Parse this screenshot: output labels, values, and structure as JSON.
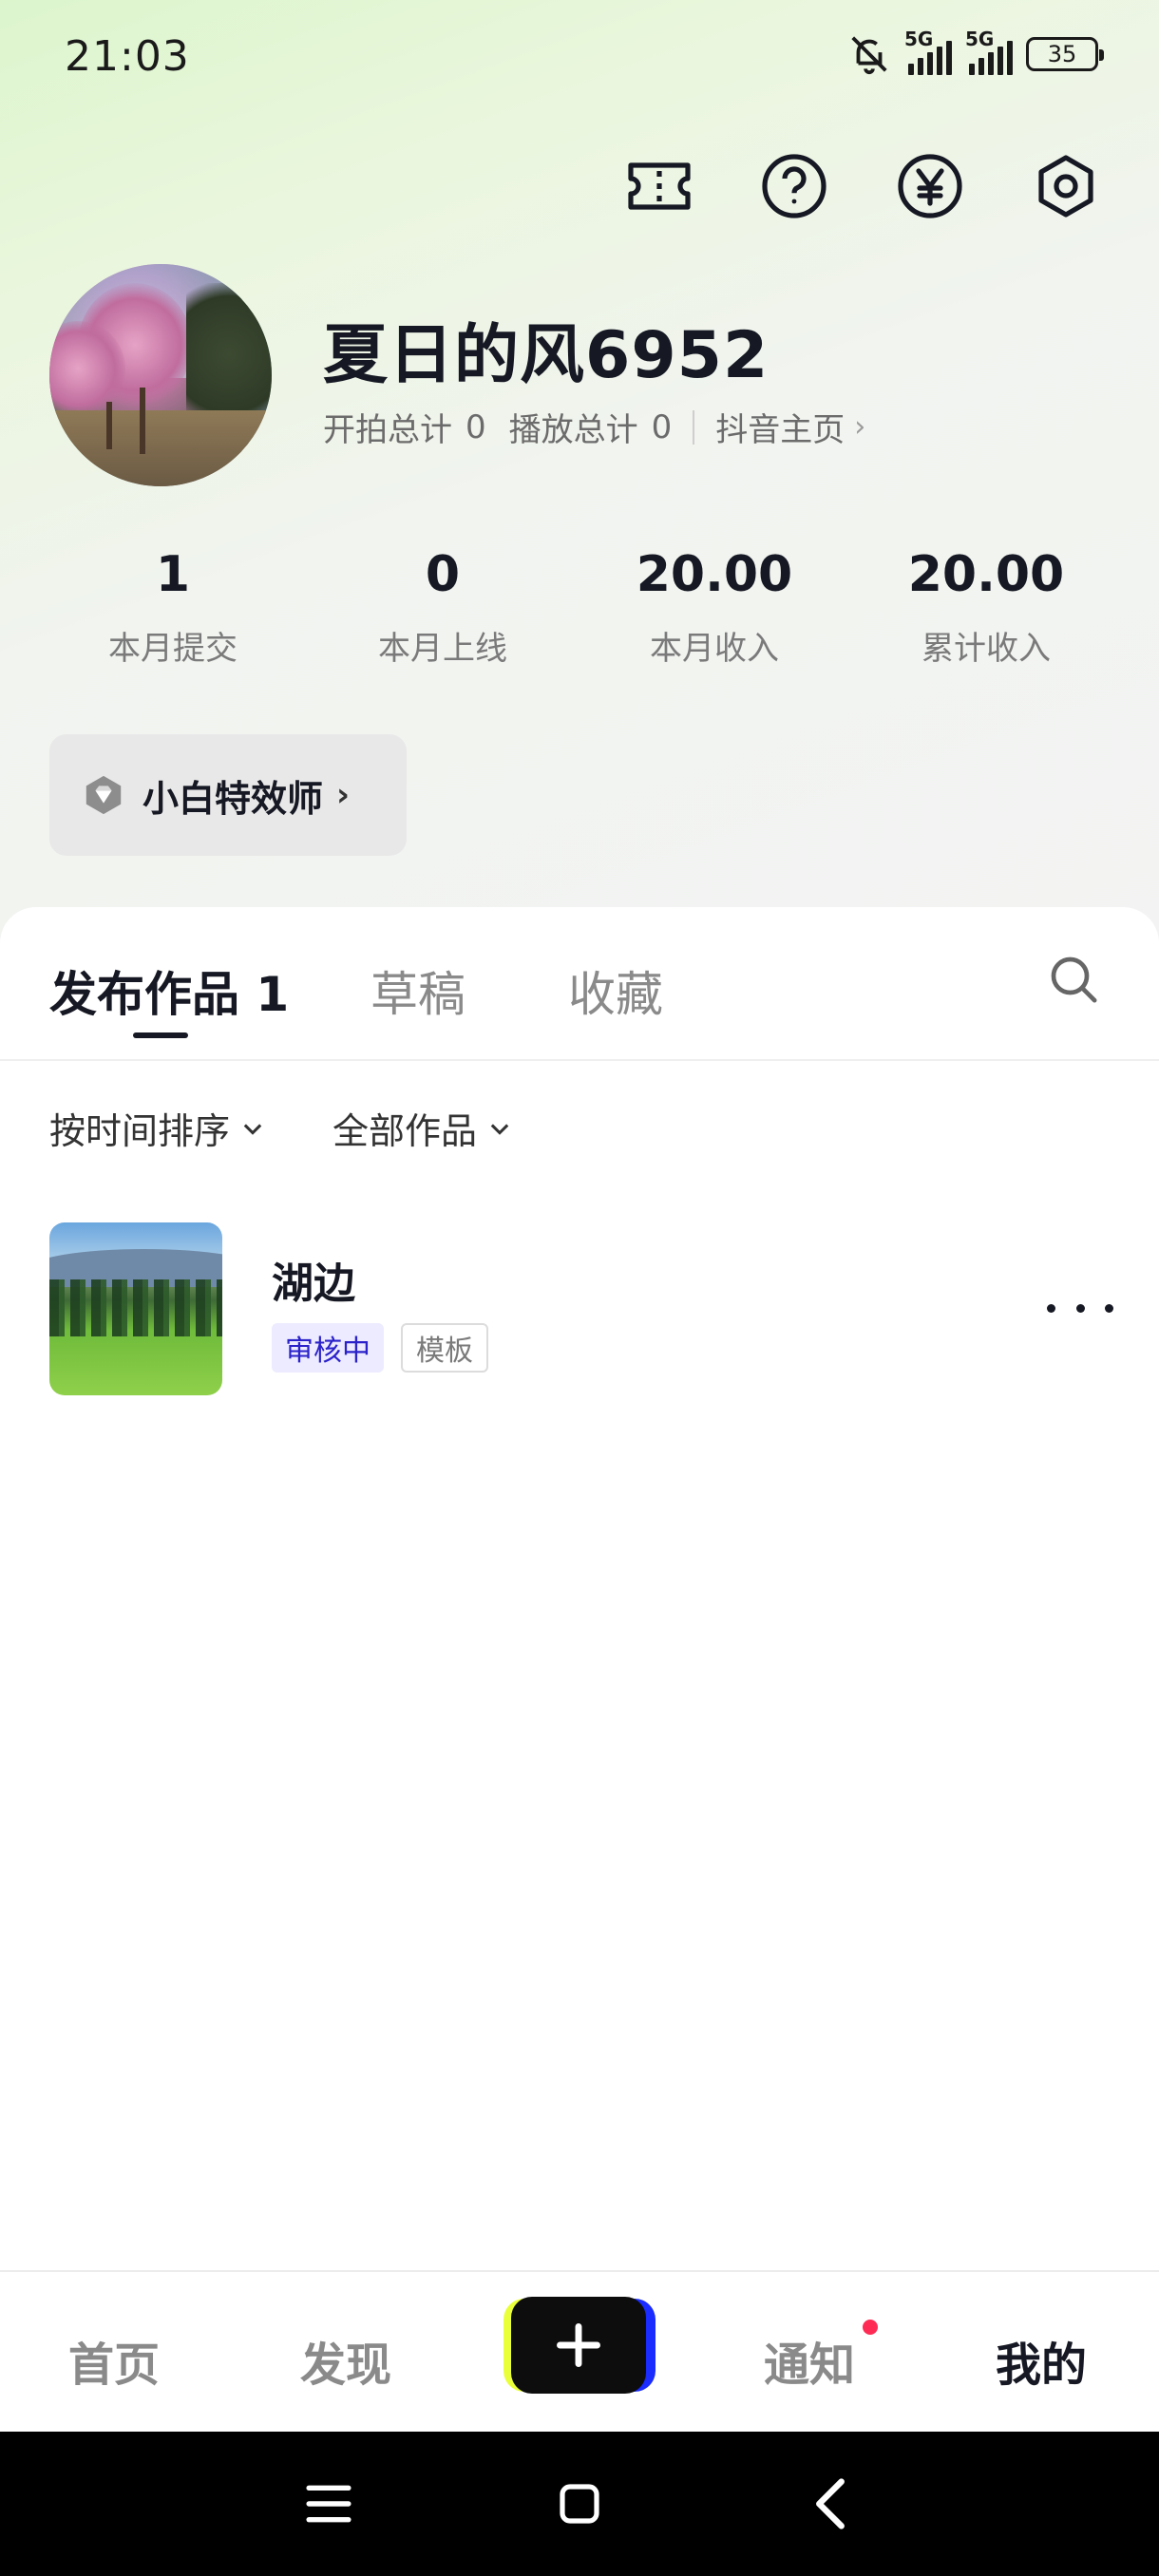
{
  "status_bar": {
    "time": "21:03",
    "signal1": "5G",
    "signal2": "5G",
    "battery": "35"
  },
  "profile": {
    "username": "夏日的风6952",
    "shoot_total_label": "开拍总计",
    "shoot_total_value": "0",
    "play_total_label": "播放总计",
    "play_total_value": "0",
    "douyin_link": "抖音主页"
  },
  "stats": [
    {
      "value": "1",
      "label": "本月提交"
    },
    {
      "value": "0",
      "label": "本月上线"
    },
    {
      "value": "20.00",
      "label": "本月收入"
    },
    {
      "value": "20.00",
      "label": "累计收入"
    }
  ],
  "level_badge": {
    "label": "小白特效师"
  },
  "tabs": [
    {
      "label": "发布作品 1",
      "active": true
    },
    {
      "label": "草稿",
      "active": false
    },
    {
      "label": "收藏",
      "active": false
    }
  ],
  "filters": {
    "sort": "按时间排序",
    "category": "全部作品"
  },
  "works": [
    {
      "title": "湖边",
      "status_tag": "审核中",
      "type_tag": "模板"
    }
  ],
  "bottom_nav": [
    {
      "label": "首页",
      "active": false
    },
    {
      "label": "发现",
      "active": false
    },
    {
      "label": "通知",
      "active": false,
      "has_dot": true
    },
    {
      "label": "我的",
      "active": true
    }
  ],
  "icons": {
    "top_actions": [
      "ticket-icon",
      "help-icon",
      "yuan-icon",
      "settings-icon"
    ],
    "create": "plus-icon",
    "search": "search-icon"
  },
  "colors": {
    "accent_review_bg": "#ecebff",
    "accent_review_text": "#2b22c9",
    "notify_dot": "#fe2c55"
  }
}
